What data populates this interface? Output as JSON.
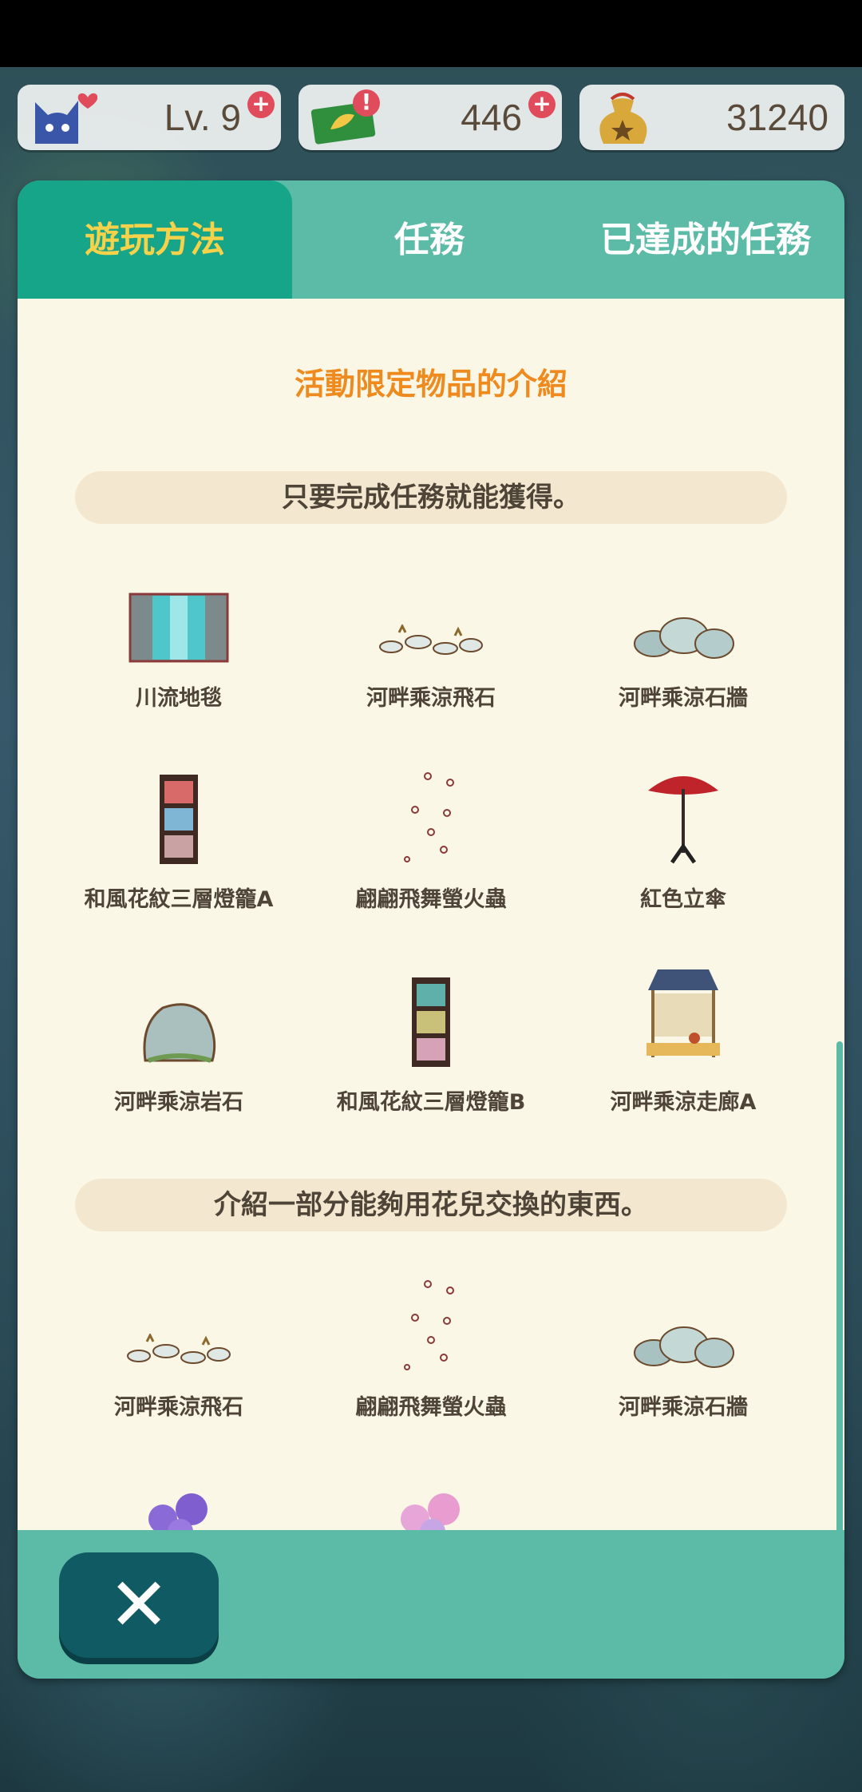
{
  "header": {
    "level": {
      "label": "Lv. 9",
      "icon": "cat-heart-icon",
      "badge_icon": "magnify-plus-icon"
    },
    "tickets": {
      "value": "446",
      "icon": "leaf-ticket-icon",
      "alert_icon": "exclamation-icon",
      "add_icon": "plus-icon"
    },
    "bells": {
      "value": "31240",
      "icon": "bell-bag-icon"
    }
  },
  "tabs": [
    {
      "label": "遊玩方法",
      "active": true
    },
    {
      "label": "任務",
      "active": false
    },
    {
      "label": "已達成的任務",
      "active": false
    }
  ],
  "content": {
    "title": "活動限定物品的介紹",
    "section1": {
      "heading": "只要完成任務就能獲得。",
      "items": [
        {
          "label": "川流地毯",
          "icon": "river-rug-icon"
        },
        {
          "label": "河畔乘涼飛石",
          "icon": "stepping-stones-icon"
        },
        {
          "label": "河畔乘涼石牆",
          "icon": "rock-wall-icon"
        },
        {
          "label": "和風花紋三層燈籠A",
          "icon": "lantern-a-icon"
        },
        {
          "label": "翩翩飛舞螢火蟲",
          "icon": "fireflies-icon"
        },
        {
          "label": "紅色立傘",
          "icon": "red-parasol-icon"
        },
        {
          "label": "河畔乘涼岩石",
          "icon": "boulder-icon"
        },
        {
          "label": "和風花紋三層燈籠B",
          "icon": "lantern-b-icon"
        },
        {
          "label": "河畔乘涼走廊A",
          "icon": "veranda-icon"
        }
      ]
    },
    "section2": {
      "heading": "介紹一部分能夠用花兒交換的東西。",
      "items": [
        {
          "label": "河畔乘涼飛石",
          "icon": "stepping-stones-icon"
        },
        {
          "label": "翩翩飛舞螢火蟲",
          "icon": "fireflies-icon"
        },
        {
          "label": "河畔乘涼石牆",
          "icon": "rock-wall-icon"
        }
      ],
      "partial_items": [
        {
          "icon": "purple-bellflower-icon"
        },
        {
          "icon": "pink-bellflower-icon"
        }
      ]
    }
  },
  "footer": {
    "close_icon": "close-icon"
  },
  "colors": {
    "tab_active_bg": "#17a589",
    "tab_active_text": "#f6d24a",
    "panel": "#5cbba7",
    "content_bg": "#fbf7e6",
    "title": "#ee8a1e",
    "close_button": "#0f5a63"
  }
}
